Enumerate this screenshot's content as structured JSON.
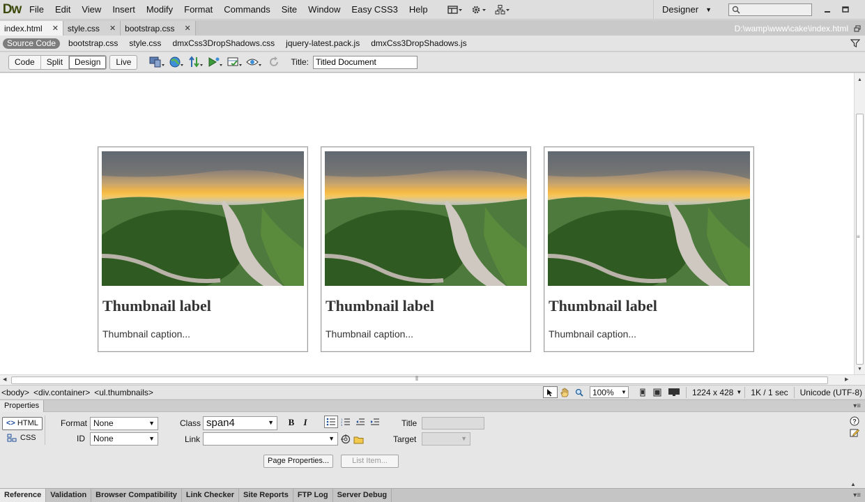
{
  "app": {
    "logo": "Dw"
  },
  "menu": [
    "File",
    "Edit",
    "View",
    "Insert",
    "Modify",
    "Format",
    "Commands",
    "Site",
    "Window",
    "Easy CSS3",
    "Help"
  ],
  "workspace": {
    "label": "Designer",
    "search_placeholder": ""
  },
  "doc_tabs": [
    {
      "label": "index.html",
      "active": true
    },
    {
      "label": "style.css",
      "active": false
    },
    {
      "label": "bootstrap.css",
      "active": false
    }
  ],
  "file_path": "D:\\wamp\\www\\cake\\index.html",
  "related_files": [
    "Source Code",
    "bootstrap.css",
    "style.css",
    "dmxCss3DropShadows.css",
    "jquery-latest.pack.js",
    "dmxCss3DropShadows.js"
  ],
  "view_modes": {
    "code": "Code",
    "split": "Split",
    "design": "Design",
    "live": "Live",
    "active": "Design"
  },
  "doc_title": {
    "label": "Title:",
    "value": "Titled Document"
  },
  "thumbnails": [
    {
      "label": "Thumbnail label",
      "caption": "Thumbnail caption..."
    },
    {
      "label": "Thumbnail label",
      "caption": "Thumbnail caption..."
    },
    {
      "label": "Thumbnail label",
      "caption": "Thumbnail caption..."
    }
  ],
  "status": {
    "tags": [
      "<body>",
      "<div.container>",
      "<ul.thumbnails>"
    ],
    "zoom": "100%",
    "window_size": "1224 x 428",
    "download": "1K / 1 sec",
    "encoding": "Unicode (UTF-8)"
  },
  "properties": {
    "panel_title": "Properties",
    "html_button": "HTML",
    "css_button": "CSS",
    "format_label": "Format",
    "format_value": "None",
    "id_label": "ID",
    "id_value": "None",
    "class_label": "Class",
    "class_value": "span4",
    "link_label": "Link",
    "link_value": "",
    "title_label": "Title",
    "target_label": "Target",
    "bold": "B",
    "italic": "I",
    "page_properties": "Page Properties...",
    "list_item": "List Item..."
  },
  "bottom_tabs": [
    "Reference",
    "Validation",
    "Browser Compatibility",
    "Link Checker",
    "Site Reports",
    "FTP Log",
    "Server Debug"
  ],
  "colors": {
    "logo": "#3c4a0e",
    "workspace_bg": "#d6d6d6",
    "sky_glow": "#f4b843",
    "forest": "#3c6a2a"
  }
}
